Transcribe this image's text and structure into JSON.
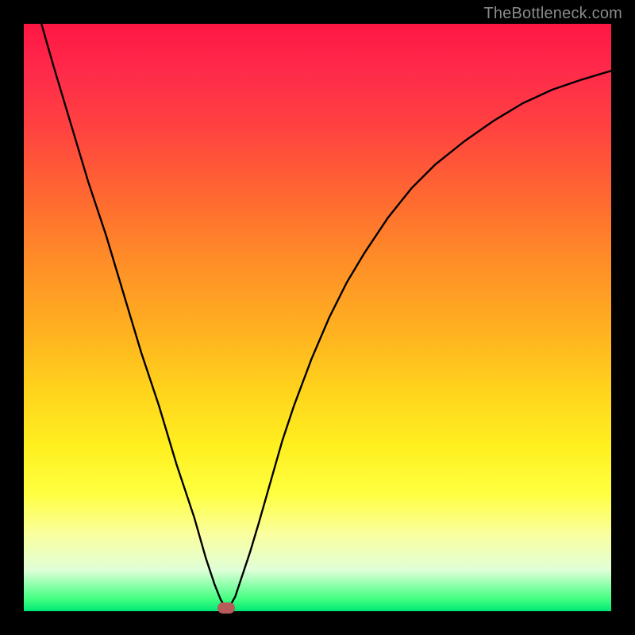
{
  "watermark": "TheBottleneck.com",
  "chart_data": {
    "type": "line",
    "title": "",
    "xlabel": "",
    "ylabel": "",
    "xlim": [
      0,
      100
    ],
    "ylim": [
      0,
      100
    ],
    "series": [
      {
        "name": "curve",
        "x": [
          3,
          5,
          8,
          11,
          14,
          17,
          20,
          23,
          26,
          29,
          31,
          32.5,
          33.5,
          34.3,
          34.6,
          35,
          36,
          37,
          38.5,
          40,
          42,
          44,
          46,
          49,
          52,
          55,
          58,
          62,
          66,
          70,
          75,
          80,
          85,
          90,
          95,
          100
        ],
        "y": [
          100,
          93,
          83,
          73,
          64,
          54,
          44,
          35,
          25,
          16,
          9,
          4.5,
          2,
          0.7,
          0.3,
          0.7,
          2.5,
          5.5,
          10,
          15,
          22,
          29,
          35,
          43,
          50,
          56,
          61,
          67,
          72,
          76,
          80,
          83.5,
          86.5,
          88.8,
          90.5,
          92
        ]
      }
    ],
    "marker": {
      "x": 34.5,
      "y": 0.5
    },
    "gradient_stops": [
      {
        "pos": 0,
        "color": "#ff1744"
      },
      {
        "pos": 50,
        "color": "#ffb020"
      },
      {
        "pos": 80,
        "color": "#ffff40"
      },
      {
        "pos": 100,
        "color": "#00e676"
      }
    ]
  }
}
